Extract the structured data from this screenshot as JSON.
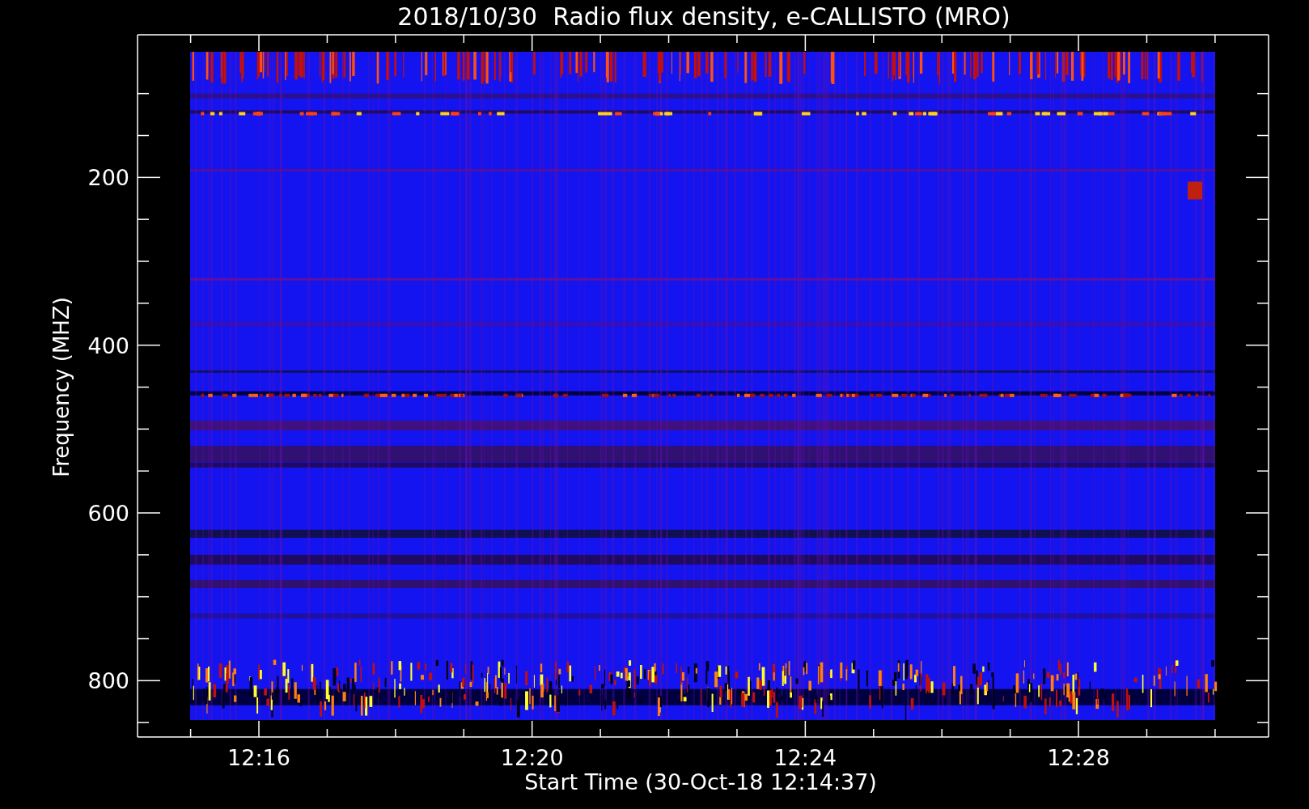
{
  "title": "2018/10/30  Radio flux density, e-CALLISTO (MRO)",
  "y_axis": {
    "label": "Frequency (MHZ)",
    "ticks": [
      "200",
      "400",
      "600",
      "800"
    ]
  },
  "x_axis": {
    "label": "Start Time (30-Oct-18 12:14:37)",
    "ticks": [
      "12:16",
      "12:20",
      "12:24",
      "12:28"
    ]
  }
}
